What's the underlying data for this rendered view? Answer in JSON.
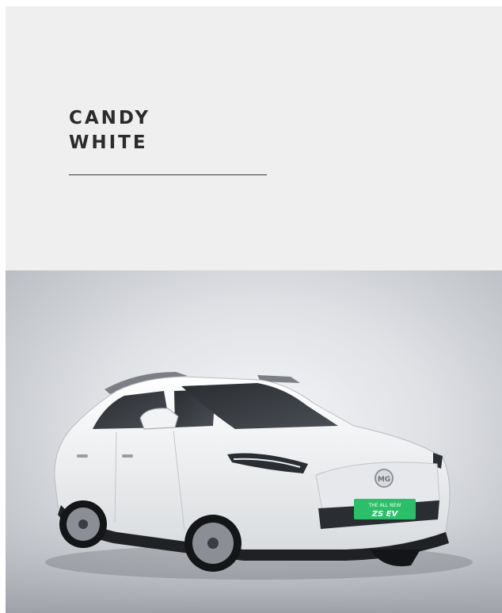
{
  "color": {
    "line1": "CANDY",
    "line2": "WHITE"
  },
  "badge": {
    "line1": "THE ALL NEW",
    "line2": "ZS EV"
  },
  "badge_color": "#2bbf6a",
  "car_color": "#f5f6f7"
}
